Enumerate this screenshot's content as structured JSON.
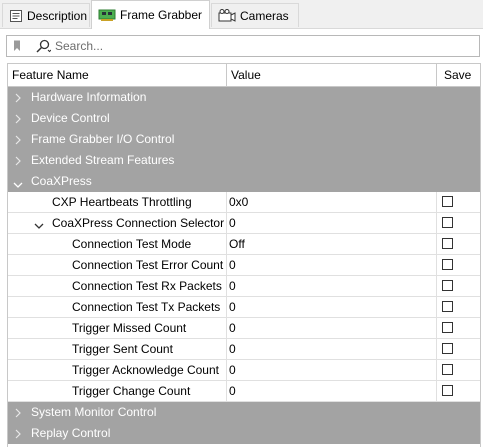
{
  "tabs": [
    {
      "label": "Description",
      "icon": "document-icon"
    },
    {
      "label": "Frame Grabber",
      "icon": "frame-grabber-card-icon",
      "active": true
    },
    {
      "label": "Cameras",
      "icon": "camera-icon"
    }
  ],
  "search": {
    "placeholder": "Search..."
  },
  "grid": {
    "headers": {
      "feature": "Feature Name",
      "value": "Value",
      "save": "Save"
    },
    "categories_top": [
      "Hardware Information",
      "Device Control",
      "Frame Grabber I/O Control",
      "Extended Stream Features"
    ],
    "coaxpress": {
      "label": "CoaXPress",
      "rows": [
        {
          "name": "CXP Heartbeats Throttling",
          "value": "0x0"
        },
        {
          "name": "CoaXPress Connection Selector",
          "value": "0"
        },
        {
          "name": "Connection Test Mode",
          "value": "Off"
        },
        {
          "name": "Connection Test Error Count",
          "value": "0"
        },
        {
          "name": "Connection Test Rx Packets",
          "value": "0"
        },
        {
          "name": "Connection Test Tx Packets",
          "value": "0"
        },
        {
          "name": "Trigger Missed Count",
          "value": "0"
        },
        {
          "name": "Trigger Sent Count",
          "value": "0"
        },
        {
          "name": "Trigger Acknowledge Count",
          "value": "0"
        },
        {
          "name": "Trigger Change Count",
          "value": "0"
        }
      ]
    },
    "categories_bottom": [
      "System Monitor Control",
      "Replay Control"
    ]
  },
  "colors": {
    "category_bg": "#a3a3a3",
    "category_text": "#ffffff"
  }
}
